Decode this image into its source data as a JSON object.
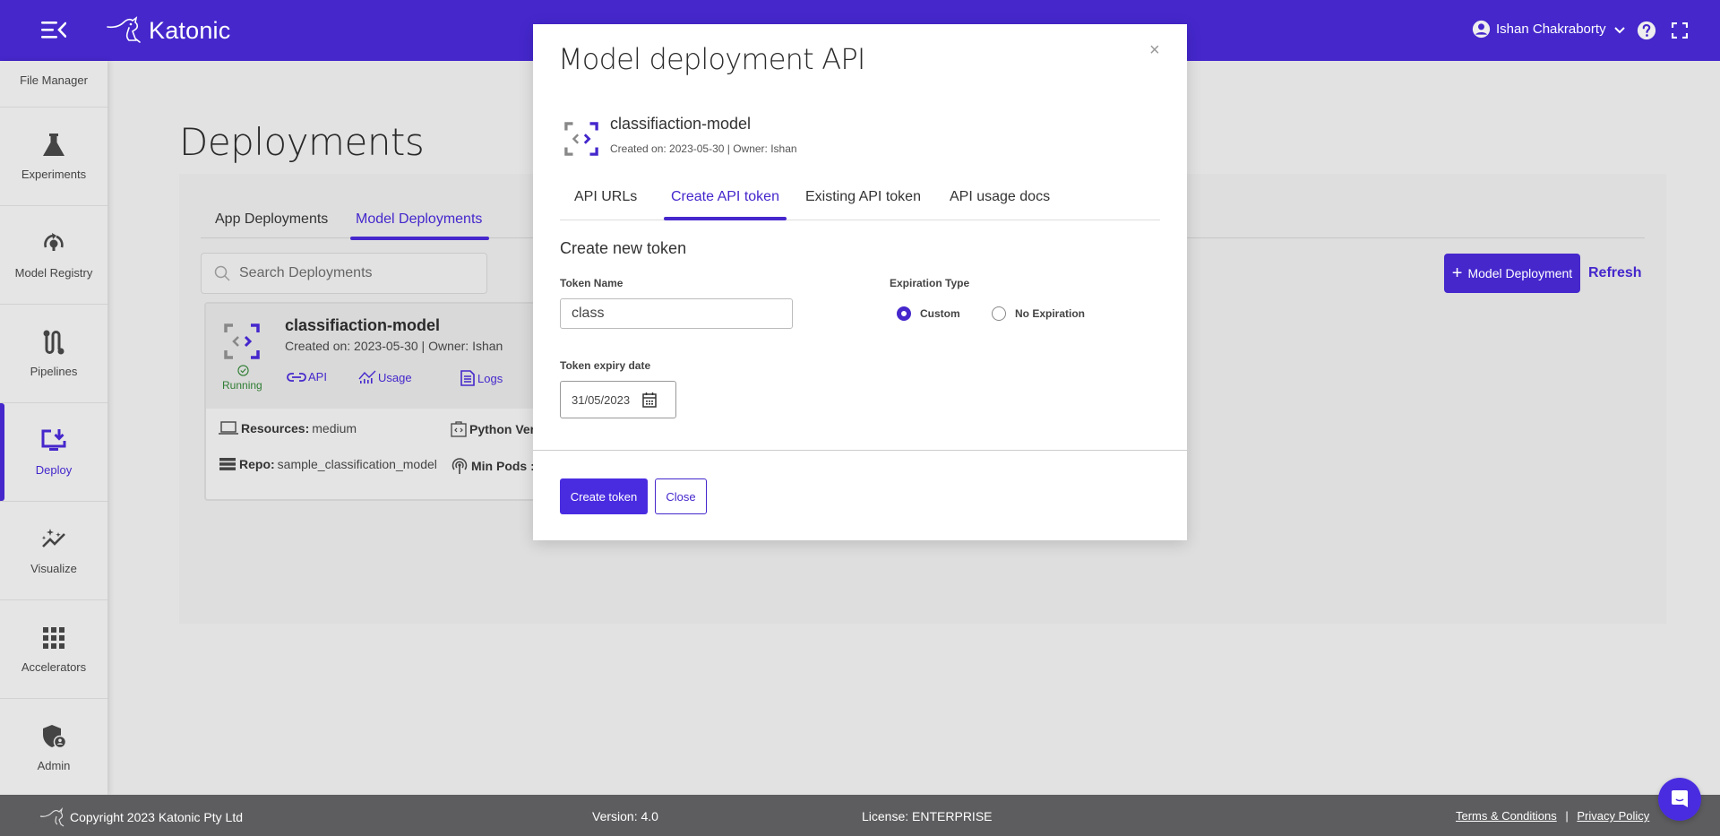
{
  "app": {
    "brand": "Katonic",
    "user_name": "Ishan Chakraborty",
    "accent_color": "#4527cc"
  },
  "sidebar": {
    "top_item": "File Manager",
    "items": [
      {
        "label": "Experiments",
        "icon": "flask-icon"
      },
      {
        "label": "Model Registry",
        "icon": "model-registry-icon"
      },
      {
        "label": "Pipelines",
        "icon": "pipeline-icon"
      },
      {
        "label": "Deploy",
        "icon": "deploy-icon",
        "active": true
      },
      {
        "label": "Visualize",
        "icon": "visualize-icon"
      },
      {
        "label": "Accelerators",
        "icon": "grid-icon"
      },
      {
        "label": "Admin",
        "icon": "admin-shield-icon"
      }
    ]
  },
  "page": {
    "title": "Deployments",
    "tabs": [
      {
        "label": "App Deployments",
        "active": false
      },
      {
        "label": "Model Deployments",
        "active": true
      }
    ],
    "search_placeholder": "Search Deployments",
    "add_button": "Model Deployment",
    "refresh": "Refresh"
  },
  "card": {
    "name": "classifiaction-model",
    "meta": "Created on: 2023-05-30 | Owner: Ishan",
    "status": "Running",
    "links": {
      "api": "API",
      "usage": "Usage",
      "logs": "Logs"
    },
    "resources_label": "Resources:",
    "resources_value": "medium",
    "python_label": "Python Ver",
    "repo_label": "Repo:",
    "repo_value": "sample_classification_model",
    "min_pods_label": "Min Pods :"
  },
  "modal": {
    "title": "Model deployment API",
    "close_symbol": "×",
    "model_name": "classifiaction-model",
    "model_meta": "Created on: 2023-05-30 | Owner: Ishan",
    "tabs": [
      {
        "label": "API URLs",
        "active": false
      },
      {
        "label": "Create API token",
        "active": true
      },
      {
        "label": "Existing API token",
        "active": false
      },
      {
        "label": "API usage docs",
        "active": false
      }
    ],
    "section_title": "Create new token",
    "token_name_label": "Token Name",
    "token_name_value": "class",
    "expiration_type_label": "Expiration Type",
    "expiration_options": [
      {
        "label": "Custom",
        "checked": true
      },
      {
        "label": "No Expiration",
        "checked": false
      }
    ],
    "expiry_date_label": "Token expiry date",
    "expiry_date_value": "31/05/2023",
    "create_button": "Create token",
    "close_button": "Close"
  },
  "footer": {
    "copyright": "Copyright 2023 Katonic Pty Ltd",
    "version": "Version: 4.0",
    "license": "License: ENTERPRISE",
    "terms": "Terms & Conditions",
    "separator": "|",
    "privacy": "Privacy Policy"
  }
}
